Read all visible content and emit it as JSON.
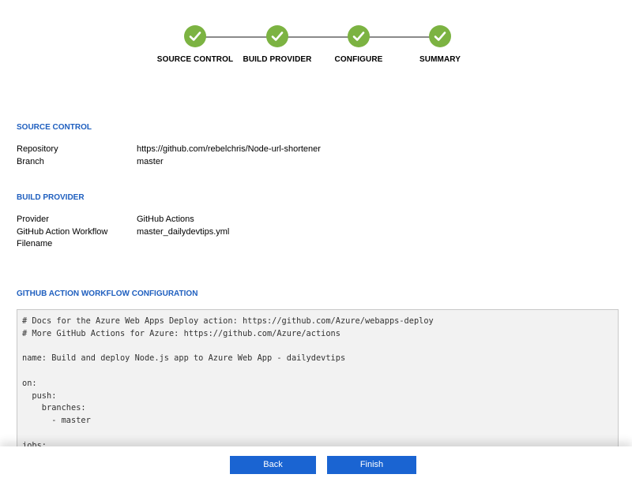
{
  "colors": {
    "accent": "#1f5fbf",
    "step_done": "#7cb342",
    "button": "#1a64d2"
  },
  "stepper": {
    "steps": [
      {
        "label": "SOURCE CONTROL",
        "icon": "check-icon"
      },
      {
        "label": "BUILD PROVIDER",
        "icon": "check-icon"
      },
      {
        "label": "CONFIGURE",
        "icon": "check-icon"
      },
      {
        "label": "SUMMARY",
        "icon": "check-icon"
      }
    ]
  },
  "source_control": {
    "title": "SOURCE CONTROL",
    "repository_label": "Repository",
    "repository_value": "https://github.com/rebelchris/Node-url-shortener",
    "branch_label": "Branch",
    "branch_value": "master"
  },
  "build_provider": {
    "title": "BUILD PROVIDER",
    "provider_label": "Provider",
    "provider_value": "GitHub Actions",
    "workflow_label_1": "GitHub Action Workflow",
    "workflow_label_2": "Filename",
    "workflow_value": "master_dailydevtips.yml"
  },
  "workflow_config": {
    "title": "GITHUB ACTION WORKFLOW CONFIGURATION",
    "lines": [
      "# Docs for the Azure Web Apps Deploy action: https://github.com/Azure/webapps-deploy",
      "# More GitHub Actions for Azure: https://github.com/Azure/actions",
      "",
      "name: Build and deploy Node.js app to Azure Web App - dailydevtips",
      "",
      "on:",
      "  push:",
      "    branches:",
      "      - master",
      "",
      "jobs:"
    ]
  },
  "footer": {
    "back_label": "Back",
    "finish_label": "Finish"
  }
}
